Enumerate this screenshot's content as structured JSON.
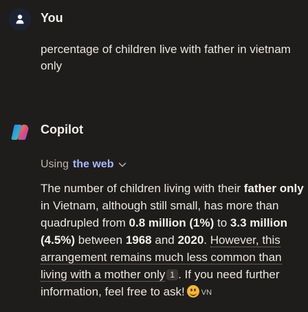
{
  "user": {
    "name": "You",
    "message": "percentage of children live with father in vietnam only"
  },
  "copilot": {
    "name": "Copilot",
    "using_prefix": "Using",
    "using_source": "the web",
    "answer": {
      "p1": "The number of children living with their ",
      "b1": "father only",
      "p2": " in Vietnam, although still small, has more than quadrupled from ",
      "b2": "0.8 million (1%)",
      "p3": " to ",
      "b3": "3.3 million (4.5%)",
      "p4": " between ",
      "b4": "1968",
      "p5": " and ",
      "b5": "2020",
      "p6": ".",
      "cited_sentence": "However, this arrangement remains much less common than living with a mother only",
      "citation_number": "1",
      "p7": ". If you need further information, feel free to ask!",
      "flag_code": "VN"
    }
  },
  "colors": {
    "background": "#1f1d1b",
    "text": "#e9e6e2",
    "link_accent": "#a8b8ff",
    "user_avatar_bg": "#1b2333"
  },
  "icons": {
    "user_avatar": "person-icon",
    "copilot_logo": "copilot-logo-icon",
    "expand": "chevron-down-icon",
    "emoji": "smiling-face-emoji-icon"
  }
}
